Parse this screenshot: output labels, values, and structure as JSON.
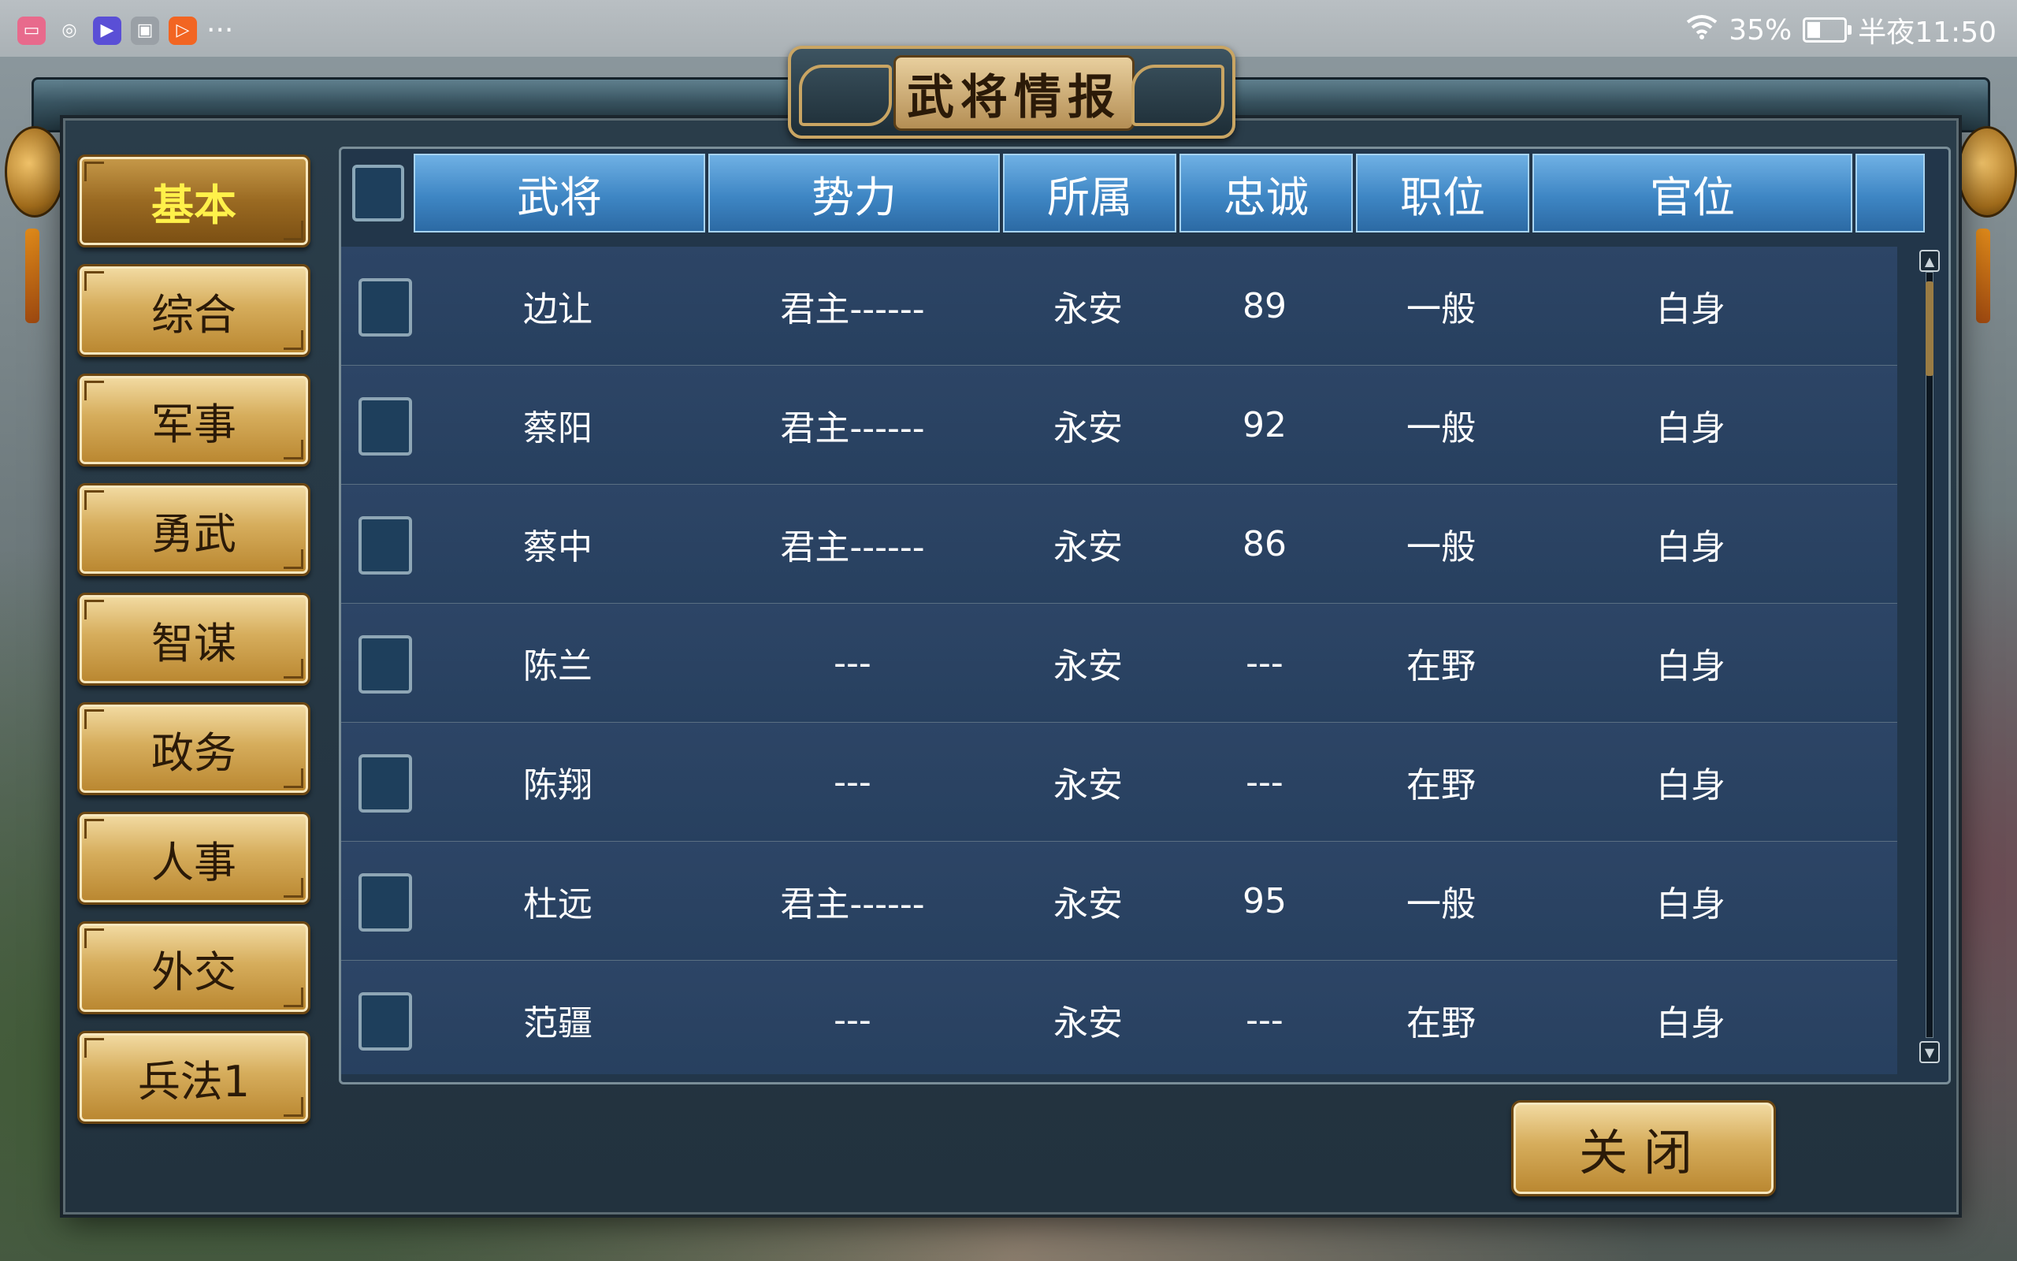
{
  "status_bar": {
    "app_icons": [
      "bilibili-icon",
      "wechat-icon",
      "video-app-icon",
      "cat-app-icon",
      "play-app-icon"
    ],
    "more": "···",
    "battery": "35%",
    "battery_level": 0.35,
    "time": "半夜11:50"
  },
  "window": {
    "title": "武将情报"
  },
  "sidebar": {
    "items": [
      {
        "label": "基本",
        "active": true
      },
      {
        "label": "综合"
      },
      {
        "label": "军事"
      },
      {
        "label": "勇武"
      },
      {
        "label": "智谋"
      },
      {
        "label": "政务"
      },
      {
        "label": "人事"
      },
      {
        "label": "外交"
      },
      {
        "label": "兵法1"
      }
    ]
  },
  "table": {
    "columns": [
      "武将",
      "势力",
      "所属",
      "忠诚",
      "职位",
      "官位",
      ""
    ],
    "rows": [
      [
        "边让",
        "君主------",
        "永安",
        "89",
        "一般",
        "白身"
      ],
      [
        "蔡阳",
        "君主------",
        "永安",
        "92",
        "一般",
        "白身"
      ],
      [
        "蔡中",
        "君主------",
        "永安",
        "86",
        "一般",
        "白身"
      ],
      [
        "陈兰",
        "---",
        "永安",
        "---",
        "在野",
        "白身"
      ],
      [
        "陈翔",
        "---",
        "永安",
        "---",
        "在野",
        "白身"
      ],
      [
        "杜远",
        "君主------",
        "永安",
        "95",
        "一般",
        "白身"
      ],
      [
        "范疆",
        "---",
        "永安",
        "---",
        "在野",
        "白身"
      ]
    ]
  },
  "buttons": {
    "close": "关闭"
  },
  "colors": {
    "header_blue": "#3e86c4",
    "gold": "#d6ad5c",
    "active_text": "#fff14a",
    "row_bg": "#2d4566"
  }
}
